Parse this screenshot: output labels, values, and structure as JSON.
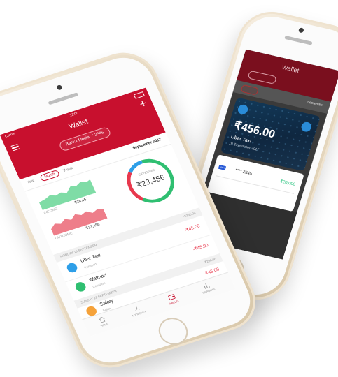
{
  "colors": {
    "brand": "#c8102e",
    "income": "#2fbf71",
    "outcome": "#e8384d",
    "accent_blue": "#2e9fe8"
  },
  "back_screen": {
    "title": "Wallet",
    "account_chip": "",
    "account_balance": "",
    "month": "September",
    "card": {
      "amount": "₹456.00",
      "name": "Uber Taxi",
      "date": "19 September 2017",
      "method": "VISA",
      "masked": "**** 2345",
      "balance": "₹20,000"
    }
  },
  "front_screen": {
    "status": {
      "carrier": "Carrier",
      "time": "12:00"
    },
    "header": {
      "title": "Wallet",
      "account": "Bank of India",
      "account_balance": "* 2345"
    },
    "period": {
      "options": [
        "Year",
        "Month",
        "Week"
      ],
      "selected": "Month",
      "label": "September 2017"
    },
    "summary": {
      "income_label": "INCOME",
      "income_value": "₹28,457",
      "outcome_label": "OUTCOME",
      "outcome_value": "₹23,456",
      "expenses_label": "EXPENSES",
      "expenses_value": "₹23,456",
      "donut_fraction_green": 0.62,
      "donut_fraction_red": 0.25,
      "donut_fraction_blue": 0.13
    },
    "sections": [
      {
        "date": "MONDAY 19 SEPTEMBER",
        "total": "-₹235.00"
      },
      {
        "date": "SUNDAY 18 SEPTEMBER",
        "total": "-₹250.00"
      }
    ],
    "transactions": [
      {
        "name": "Uber Taxi",
        "category": "Transport",
        "amount": "-₹45.00",
        "icon": "car-icon",
        "color": "#2e9fe8"
      },
      {
        "name": "Walmart",
        "category": "Transport",
        "amount": "-₹45.00",
        "icon": "cart-icon",
        "color": "#2fbf71"
      },
      {
        "name": "Salary",
        "category": "Salary",
        "amount": "-₹45.00",
        "icon": "salary-icon",
        "color": "#f5a23a"
      }
    ],
    "tabs": [
      {
        "label": "HOME",
        "icon": "home-icon"
      },
      {
        "label": "MY MONEY",
        "icon": "money-icon"
      },
      {
        "label": "WALLET",
        "icon": "wallet-icon",
        "active": true
      },
      {
        "label": "REPORTS",
        "icon": "chart-icon"
      }
    ]
  }
}
